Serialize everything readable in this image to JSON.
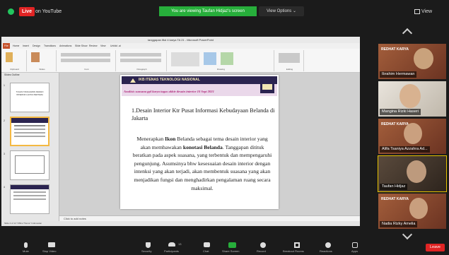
{
  "zoom": {
    "live_badge": "Live",
    "live_on": "on YouTube",
    "share_banner": "You are viewing Taufan Hidjaz's screen",
    "view_options": "View Options ⌄",
    "view_button": "View",
    "end_button": "Leave"
  },
  "ppt": {
    "window_title": "tanggapan ifkd 4 karya TA 21 - Microsoft PowerPoint",
    "tabs": [
      "File",
      "Home",
      "Insert",
      "Design",
      "Transitions",
      "Animations",
      "Slide Show",
      "Review",
      "View",
      "Unfold .ai"
    ],
    "ribbon_groups": [
      "Clipboard",
      "Slides",
      "Font",
      "Paragraph",
      "Drawing",
      "Editing"
    ],
    "left_tabs": "Slides   Outline",
    "thumb_text": "TUGAS TANGGAPAN DESAIN INTERIOR LANTAI PERTAMA",
    "notes_placeholder": "Click to add notes",
    "status_text": "Slide 4 of 14   \"Office Theme\"   Indonesian"
  },
  "slide": {
    "banner_top": "IKB ITENAS TEKNOLOGI NASIONAL",
    "banner_sub": "Analisis suasana ppl karya tugas akhir desain interior 10 Sept 2021",
    "title": "1.Desain Interior Ktr Pusat Informasi Kebudayaan Belanda di Jakarta",
    "body_part1": "Menerapkan ",
    "body_bold1": "Ikon",
    "body_part2": " Belanda sebagai tema desain interior yang akan membawakan ",
    "body_bold2": "konotasi Belanda",
    "body_part3": ". Tanggapan ditituk beratkan pada aspek suasana, yang terbentuk dan mempengaruhi pengunjung. Asumsinya bhw kesesuaian desain interior dengan intenksi yang akan terjadi, akan membentuk suasana yang akan menjadikan fungsi dan menghadirkan pengalaman ruang secara maksimal."
  },
  "participants": [
    {
      "name": "Ibrahim Hermawan",
      "brand": "REDHAT KARYA"
    },
    {
      "name": "Mangina Rizki Haseri",
      "brand": ""
    },
    {
      "name": "Alifa Tsaniya Azzahra Ad...",
      "brand": "REDHAT KARYA"
    },
    {
      "name": "Taufan Hidjaz",
      "brand": ""
    },
    {
      "name": "Nadia Rizky Amelia",
      "brand": "REDHAT KARYA"
    }
  ],
  "toolbar": [
    {
      "label": "Mute",
      "icon": "microphone-icon"
    },
    {
      "label": "Stop Video",
      "icon": "video-camera-icon"
    },
    {
      "label": "Security",
      "icon": "shield-icon"
    },
    {
      "label": "Participants",
      "icon": "participants-icon",
      "count": "13"
    },
    {
      "label": "Chat",
      "icon": "chat-icon"
    },
    {
      "label": "Share Screen",
      "icon": "share-screen-icon"
    },
    {
      "label": "Record",
      "icon": "record-icon"
    },
    {
      "label": "Breakout Rooms",
      "icon": "breakout-rooms-icon"
    },
    {
      "label": "Reactions",
      "icon": "reactions-icon"
    },
    {
      "label": "Apps",
      "icon": "apps-icon"
    }
  ],
  "colors": {
    "accent_green": "#27ae3b",
    "live_red": "#e02424",
    "slide_banner": "#2b2450"
  }
}
